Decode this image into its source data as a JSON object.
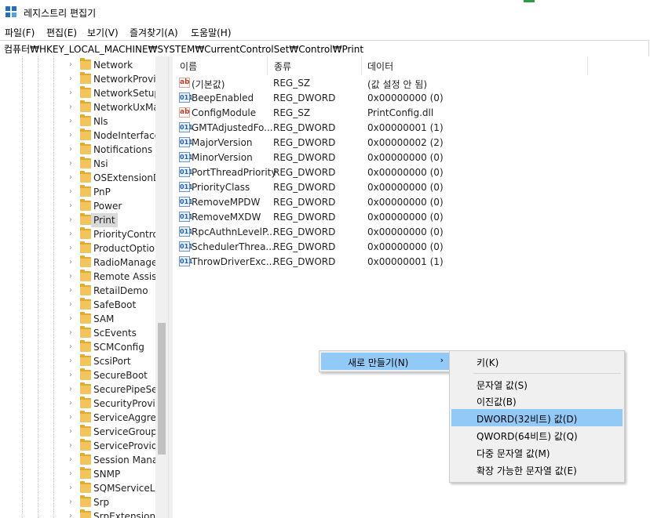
{
  "window": {
    "title": "레지스트리 편집기"
  },
  "menubar": {
    "items": [
      "파일(F)",
      "편집(E)",
      "보기(V)",
      "즐겨찾기(A)",
      "도움말(H)"
    ]
  },
  "address": {
    "path": "컴퓨터₩HKEY_LOCAL_MACHINE₩SYSTEM₩CurrentControlSet₩Control₩Print"
  },
  "tree": {
    "items": [
      "Network",
      "NetworkProvid",
      "NetworkSetup",
      "NetworkUxMa",
      "Nls",
      "NodeInterface",
      "Notifications",
      "Nsi",
      "OSExtensionD",
      "PnP",
      "Power",
      "Print",
      "PriorityContro",
      "ProductOption",
      "RadioManager",
      "Remote Assist",
      "RetailDemo",
      "SafeBoot",
      "SAM",
      "ScEvents",
      "SCMConfig",
      "ScsiPort",
      "SecureBoot",
      "SecurePipeSer",
      "SecurityProvid",
      "ServiceAggreg",
      "ServiceGroupO",
      "ServiceProvide",
      "Session Mana",
      "SNMP",
      "SQMServiceLi",
      "Srp",
      "SrpExtensionC"
    ],
    "selected": "Print"
  },
  "list": {
    "headers": {
      "name": "이름",
      "type": "종류",
      "data": "데이터"
    },
    "rows": [
      {
        "icon": "string-value-icon",
        "name": "(기본값)",
        "type": "REG_SZ",
        "data": "(값 설정 안 됨)"
      },
      {
        "icon": "binary-value-icon",
        "name": "BeepEnabled",
        "type": "REG_DWORD",
        "data": "0x00000000 (0)"
      },
      {
        "icon": "string-value-icon",
        "name": "ConfigModule",
        "type": "REG_SZ",
        "data": "PrintConfig.dll"
      },
      {
        "icon": "binary-value-icon",
        "name": "GMTAdjustedFo...",
        "type": "REG_DWORD",
        "data": "0x00000001 (1)"
      },
      {
        "icon": "binary-value-icon",
        "name": "MajorVersion",
        "type": "REG_DWORD",
        "data": "0x00000002 (2)"
      },
      {
        "icon": "binary-value-icon",
        "name": "MinorVersion",
        "type": "REG_DWORD",
        "data": "0x00000000 (0)"
      },
      {
        "icon": "binary-value-icon",
        "name": "PortThreadPriority",
        "type": "REG_DWORD",
        "data": "0x00000000 (0)"
      },
      {
        "icon": "binary-value-icon",
        "name": "PriorityClass",
        "type": "REG_DWORD",
        "data": "0x00000000 (0)"
      },
      {
        "icon": "binary-value-icon",
        "name": "RemoveMPDW",
        "type": "REG_DWORD",
        "data": "0x00000000 (0)"
      },
      {
        "icon": "binary-value-icon",
        "name": "RemoveMXDW",
        "type": "REG_DWORD",
        "data": "0x00000000 (0)"
      },
      {
        "icon": "binary-value-icon",
        "name": "RpcAuthnLevelP...",
        "type": "REG_DWORD",
        "data": "0x00000000 (0)"
      },
      {
        "icon": "binary-value-icon",
        "name": "SchedulerThrea...",
        "type": "REG_DWORD",
        "data": "0x00000000 (0)"
      },
      {
        "icon": "binary-value-icon",
        "name": "ThrowDriverExc...",
        "type": "REG_DWORD",
        "data": "0x00000001 (1)"
      }
    ]
  },
  "context_menu": {
    "new_label": "새로 만들기(N)",
    "submenu": {
      "key": "키(K)",
      "string": "문자열 값(S)",
      "binary": "이진값(B)",
      "dword": "DWORD(32비트) 값(D)",
      "qword": "QWORD(64비트) 값(Q)",
      "multi_string": "다중 문자열 값(M)",
      "expandable_string": "확장 가능한 문자열 값(E)",
      "highlighted": "DWORD(32비트) 값(D)"
    }
  },
  "icons": {
    "string_glyph": "ab",
    "binary_glyph": "011",
    "submenu_arrow": "›",
    "tree_arrow": "›"
  },
  "colors": {
    "highlight": "#91c9f7",
    "folder": "#f2c55c",
    "menu_bg": "#f0f0f0"
  }
}
